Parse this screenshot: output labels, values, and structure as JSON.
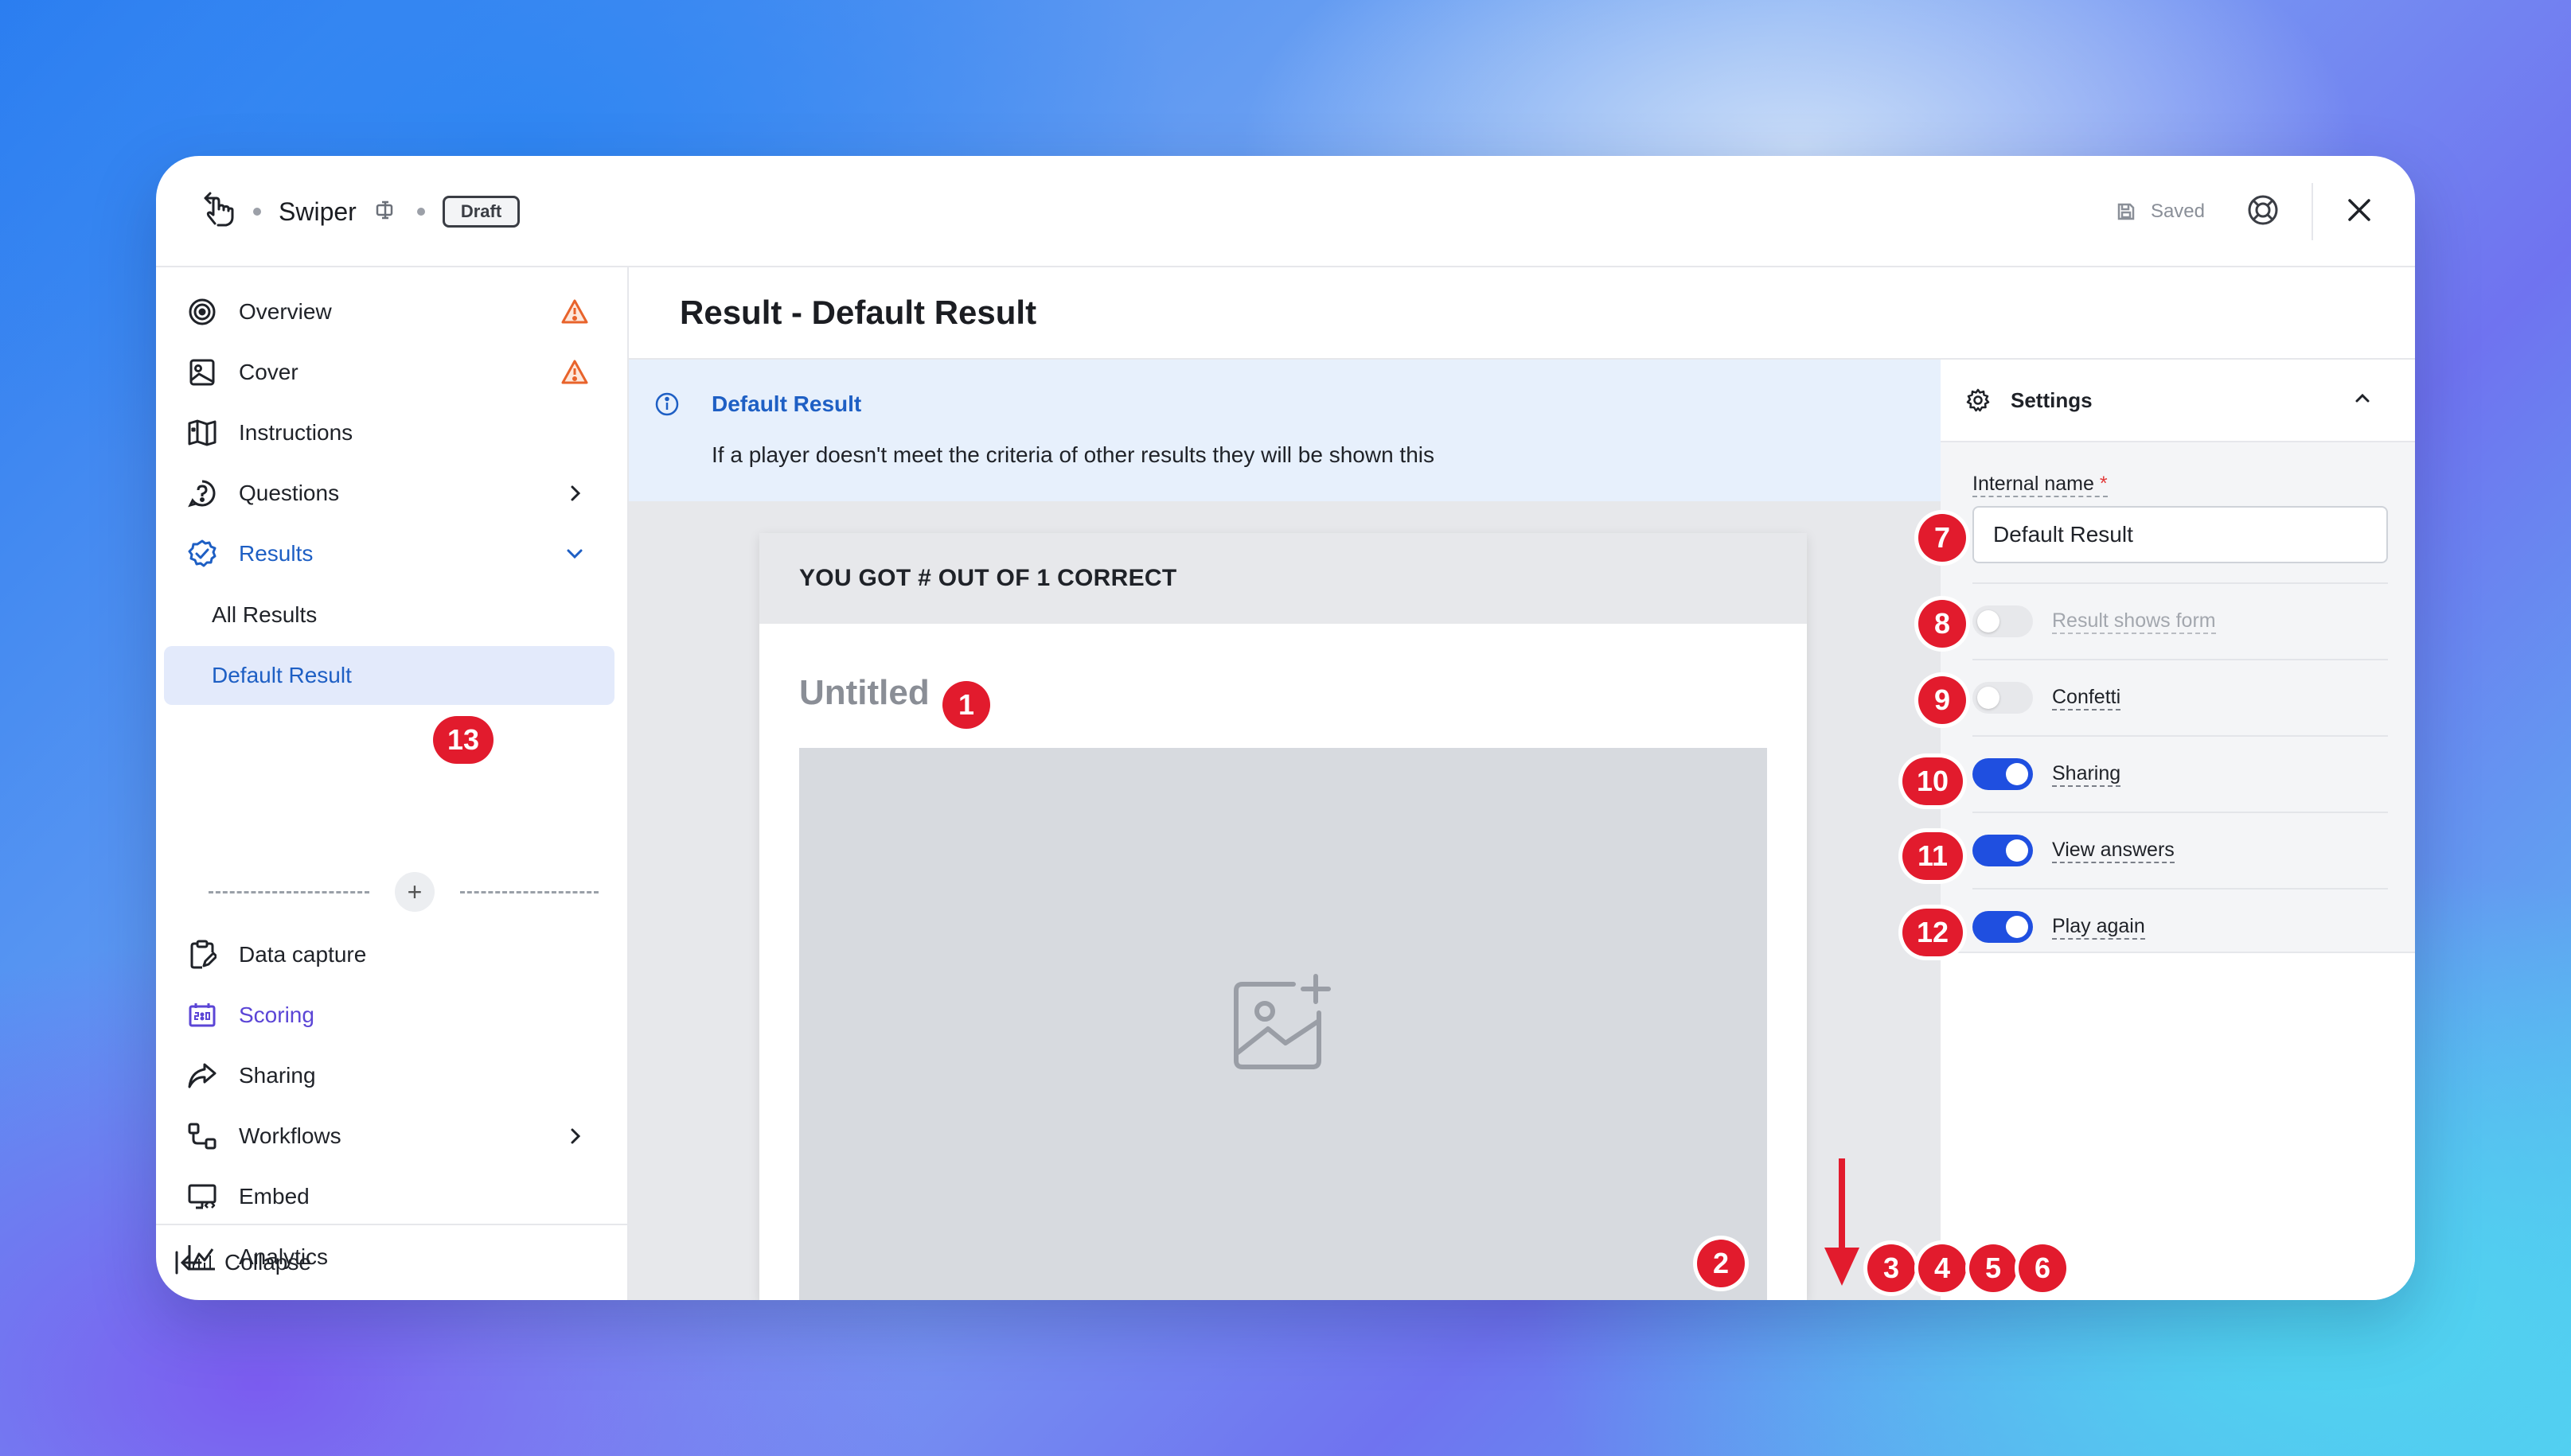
{
  "topbar": {
    "app_name": "Swiper",
    "status": "Draft",
    "saved_label": "Saved"
  },
  "sidebar": {
    "items": [
      {
        "label": "Overview",
        "icon": "target-icon",
        "warning": true
      },
      {
        "label": "Cover",
        "icon": "image-icon",
        "warning": true
      },
      {
        "label": "Instructions",
        "icon": "map-icon"
      },
      {
        "label": "Questions",
        "icon": "question-icon",
        "trail": "chevron-right"
      },
      {
        "label": "Results",
        "icon": "check-badge-icon",
        "trail": "chevron-down"
      },
      {
        "label": "Data capture",
        "icon": "clipboard-icon"
      },
      {
        "label": "Scoring",
        "icon": "scoreboard-icon"
      },
      {
        "label": "Sharing",
        "icon": "share-icon"
      },
      {
        "label": "Workflows",
        "icon": "workflow-icon",
        "trail": "chevron-right"
      },
      {
        "label": "Embed",
        "icon": "embed-icon"
      },
      {
        "label": "Analytics",
        "icon": "chart-icon"
      }
    ],
    "sub_items": [
      "All Results",
      "Default Result"
    ],
    "collapse_label": "Collapse"
  },
  "main": {
    "page_title": "Result - Default Result",
    "info": {
      "title": "Default Result",
      "text": "If a player doesn't meet the criteria of other results they will be shown this"
    },
    "card": {
      "header": "YOU GOT # OUT OF 1 CORRECT",
      "title": "Untitled"
    }
  },
  "settings": {
    "title": "Settings",
    "internal_name_label": "Internal name",
    "required_mark": "*",
    "internal_name_value": "Default Result",
    "toggles": [
      {
        "label": "Result shows form",
        "on": false,
        "disabled": true
      },
      {
        "label": "Confetti",
        "on": false
      },
      {
        "label": "Sharing",
        "on": true
      },
      {
        "label": "View answers",
        "on": true
      },
      {
        "label": "Play again",
        "on": true
      }
    ]
  },
  "markers": [
    "1",
    "2",
    "3",
    "4",
    "5",
    "6",
    "7",
    "8",
    "9",
    "10",
    "11",
    "12",
    "13"
  ],
  "colors": {
    "accent": "#1e5fc4",
    "toggle_on": "#1f4fe0",
    "marker": "#e21b2d",
    "warning": "#e8632b"
  }
}
